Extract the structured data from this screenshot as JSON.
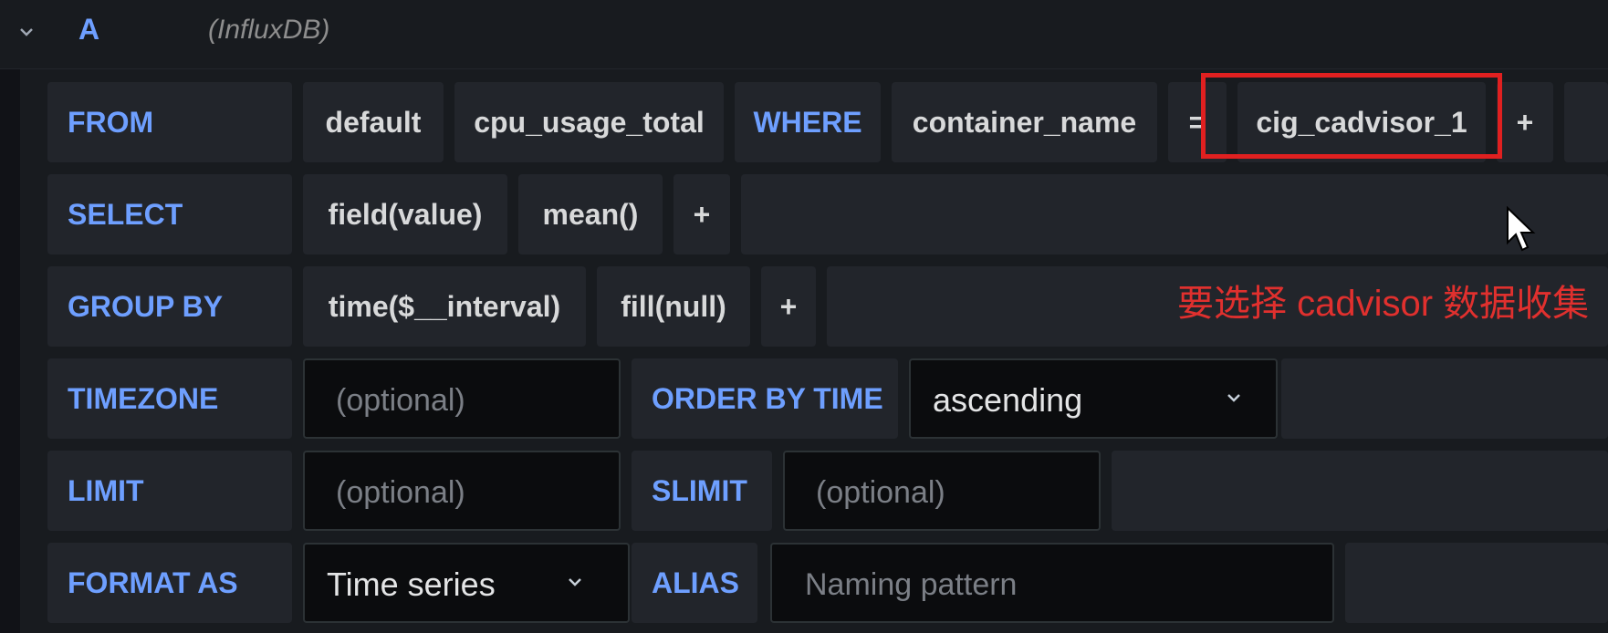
{
  "query": {
    "ref_id": "A",
    "datasource": "(InfluxDB)"
  },
  "rows": {
    "from": {
      "keyword": "FROM",
      "policy": "default",
      "measurement": "cpu_usage_total",
      "where_keyword": "WHERE",
      "tag_key": "container_name",
      "operator": "=",
      "tag_value": "cig_cadvisor_1",
      "add": "+"
    },
    "select": {
      "keyword": "SELECT",
      "field": "field(value)",
      "aggregation": "mean()",
      "add": "+"
    },
    "group_by": {
      "keyword": "GROUP BY",
      "time": "time($__interval)",
      "fill": "fill(null)",
      "add": "+"
    },
    "timezone": {
      "keyword": "TIMEZONE",
      "placeholder": "(optional)",
      "order_keyword": "ORDER BY TIME",
      "order_value": "ascending"
    },
    "limit": {
      "keyword": "LIMIT",
      "placeholder": "(optional)",
      "slimit_keyword": "SLIMIT",
      "slimit_placeholder": "(optional)"
    },
    "format": {
      "keyword": "FORMAT AS",
      "value": "Time series",
      "alias_keyword": "ALIAS",
      "alias_placeholder": "Naming pattern"
    }
  },
  "annotation": {
    "text": "要选择 cadvisor 数据收集",
    "color": "#e02020"
  },
  "colors": {
    "keyword": "#6e9fff",
    "segment_bg": "#22252b",
    "panel_bg": "#181b1f",
    "input_bg": "#0b0c0e"
  },
  "icons": {
    "collapse": "chevron-down-icon",
    "dropdown": "chevron-down-icon",
    "cursor": "mouse-pointer-icon"
  }
}
